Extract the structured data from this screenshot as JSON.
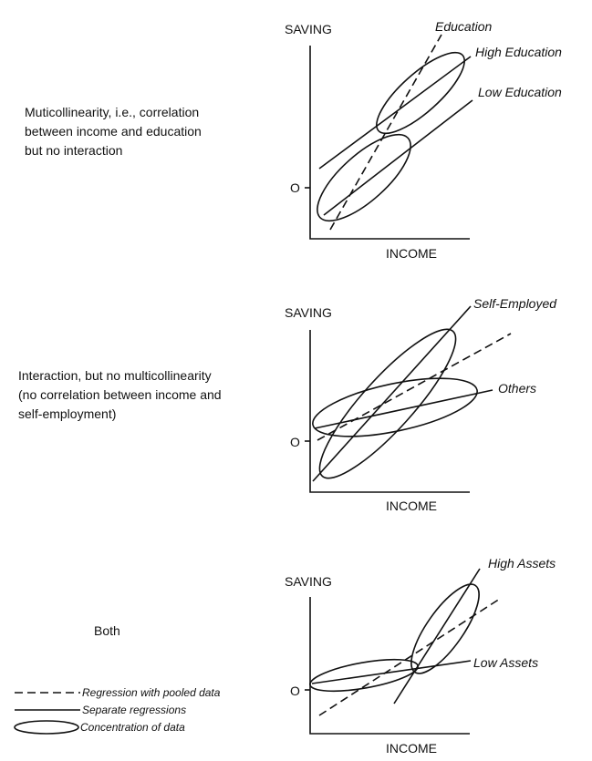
{
  "panels": [
    {
      "description": "Muticollinearity, i.e., correlation\nbetween income and education\nbut no interaction",
      "y_label": "SAVING",
      "x_label": "INCOME",
      "origin_label": "O",
      "curves": [
        "Education",
        "High Education",
        "Low Education"
      ]
    },
    {
      "description": "Interaction, but no multicollinearity\n(no correlation between income and\nself-employment)",
      "y_label": "SAVING",
      "x_label": "INCOME",
      "origin_label": "O",
      "curves": [
        "Self-Employed",
        "Others"
      ]
    },
    {
      "description": "Both",
      "y_label": "SAVING",
      "x_label": "INCOME",
      "origin_label": "O",
      "curves": [
        "High Assets",
        "Low Assets"
      ]
    }
  ],
  "legend": {
    "pooled": "Regression with pooled data",
    "separate": "Separate regressions",
    "concentration": "Concentration of data"
  }
}
